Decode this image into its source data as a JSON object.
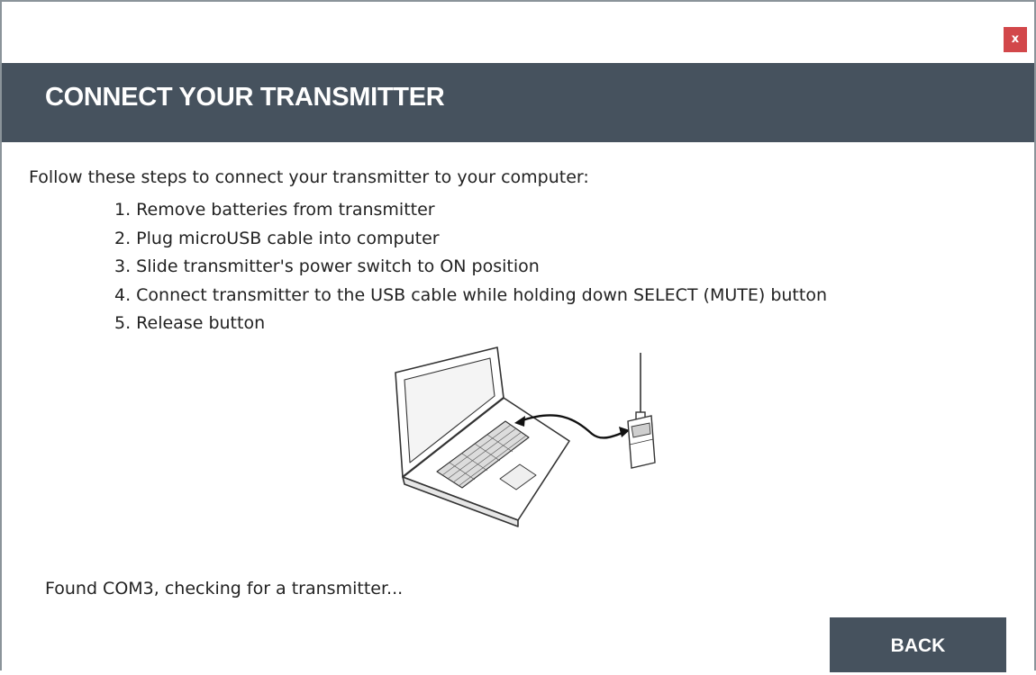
{
  "window": {
    "close_label": "x"
  },
  "header": {
    "title": "CONNECT YOUR TRANSMITTER"
  },
  "main": {
    "intro": "Follow these steps to connect your transmitter to your computer:",
    "steps": [
      "1. Remove batteries from transmitter",
      "2. Plug microUSB cable into computer",
      "3. Slide transmitter's power switch to ON position",
      "4. Connect transmitter to the USB cable while holding down SELECT (MUTE) button",
      "5. Release button"
    ],
    "illustration_icon": "laptop-transmitter-usb-illustration",
    "status": "Found COM3, checking for a transmitter..."
  },
  "footer": {
    "back_label": "BACK"
  },
  "colors": {
    "header_bg": "#46525e",
    "close_bg": "#d2474a",
    "text": "#222222"
  }
}
